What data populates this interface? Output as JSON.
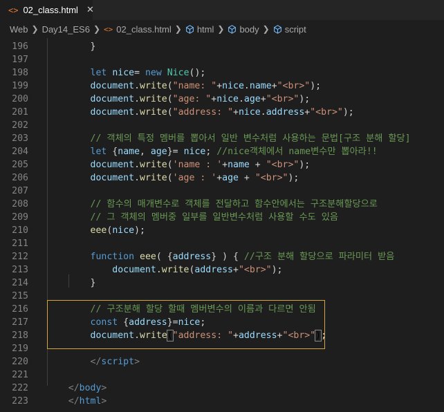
{
  "tab": {
    "title": "02_class.html",
    "icon": "html-file-icon",
    "close": "✕"
  },
  "breadcrumb": [
    "Web",
    "Day14_ES6",
    "02_class.html",
    "html",
    "body",
    "script"
  ],
  "colors": {
    "background": "#1e1e1e",
    "keyword": "#569cd6",
    "string": "#ce9178",
    "comment": "#6a9955",
    "function": "#dcdcaa",
    "variable": "#9cdcfe",
    "highlight_border": "#d7a63a"
  },
  "lines": [
    {
      "n": "196",
      "t": [
        [
          "pl",
          "        }"
        ]
      ]
    },
    {
      "n": "197",
      "t": []
    },
    {
      "n": "198",
      "t": [
        [
          "pl",
          "        "
        ],
        [
          "kw",
          "let"
        ],
        [
          "pl",
          " "
        ],
        [
          "var",
          "nice"
        ],
        [
          "pl",
          "= "
        ],
        [
          "kw",
          "new"
        ],
        [
          "pl",
          " "
        ],
        [
          "cls",
          "Nice"
        ],
        [
          "pl",
          "();"
        ]
      ]
    },
    {
      "n": "199",
      "t": [
        [
          "pl",
          "        "
        ],
        [
          "var",
          "document"
        ],
        [
          "pl",
          "."
        ],
        [
          "fn",
          "write"
        ],
        [
          "pl",
          "("
        ],
        [
          "str",
          "\"name: \""
        ],
        [
          "pl",
          "+"
        ],
        [
          "var",
          "nice"
        ],
        [
          "pl",
          "."
        ],
        [
          "var",
          "name"
        ],
        [
          "pl",
          "+"
        ],
        [
          "str",
          "\"<br>\""
        ],
        [
          "pl",
          ");"
        ]
      ]
    },
    {
      "n": "200",
      "t": [
        [
          "pl",
          "        "
        ],
        [
          "var",
          "document"
        ],
        [
          "pl",
          "."
        ],
        [
          "fn",
          "write"
        ],
        [
          "pl",
          "("
        ],
        [
          "str",
          "\"age: \""
        ],
        [
          "pl",
          "+"
        ],
        [
          "var",
          "nice"
        ],
        [
          "pl",
          "."
        ],
        [
          "var",
          "age"
        ],
        [
          "pl",
          "+"
        ],
        [
          "str",
          "\"<br>\""
        ],
        [
          "pl",
          ");"
        ]
      ]
    },
    {
      "n": "201",
      "t": [
        [
          "pl",
          "        "
        ],
        [
          "var",
          "document"
        ],
        [
          "pl",
          "."
        ],
        [
          "fn",
          "write"
        ],
        [
          "pl",
          "("
        ],
        [
          "str",
          "\"address: \""
        ],
        [
          "pl",
          "+"
        ],
        [
          "var",
          "nice"
        ],
        [
          "pl",
          "."
        ],
        [
          "var",
          "address"
        ],
        [
          "pl",
          "+"
        ],
        [
          "str",
          "\"<br>\""
        ],
        [
          "pl",
          ");"
        ]
      ]
    },
    {
      "n": "202",
      "t": []
    },
    {
      "n": "203",
      "t": [
        [
          "pl",
          "        "
        ],
        [
          "cmt",
          "// 객체의 특정 멤버를 뽑아서 일반 변수처럼 사용하는 문법[구조 분해 할당]"
        ]
      ]
    },
    {
      "n": "204",
      "t": [
        [
          "pl",
          "        "
        ],
        [
          "kw",
          "let"
        ],
        [
          "pl",
          " {"
        ],
        [
          "var",
          "name"
        ],
        [
          "pl",
          ", "
        ],
        [
          "var",
          "age"
        ],
        [
          "pl",
          "}= "
        ],
        [
          "var",
          "nice"
        ],
        [
          "pl",
          "; "
        ],
        [
          "cmt",
          "//nice객체에서 name변수만 뽑아라!!"
        ]
      ]
    },
    {
      "n": "205",
      "t": [
        [
          "pl",
          "        "
        ],
        [
          "var",
          "document"
        ],
        [
          "pl",
          "."
        ],
        [
          "fn",
          "write"
        ],
        [
          "pl",
          "("
        ],
        [
          "str",
          "'name : '"
        ],
        [
          "pl",
          "+"
        ],
        [
          "var",
          "name"
        ],
        [
          "pl",
          " + "
        ],
        [
          "str",
          "\"<br>\""
        ],
        [
          "pl",
          ");"
        ]
      ]
    },
    {
      "n": "206",
      "t": [
        [
          "pl",
          "        "
        ],
        [
          "var",
          "document"
        ],
        [
          "pl",
          "."
        ],
        [
          "fn",
          "write"
        ],
        [
          "pl",
          "("
        ],
        [
          "str",
          "'age : '"
        ],
        [
          "pl",
          "+"
        ],
        [
          "var",
          "age"
        ],
        [
          "pl",
          " + "
        ],
        [
          "str",
          "\"<br>\""
        ],
        [
          "pl",
          ");"
        ]
      ]
    },
    {
      "n": "207",
      "t": []
    },
    {
      "n": "208",
      "t": [
        [
          "pl",
          "        "
        ],
        [
          "cmt",
          "// 함수의 매개변수로 객체를 전달하고 함수안에서는 구조분해할당으로"
        ]
      ]
    },
    {
      "n": "209",
      "t": [
        [
          "pl",
          "        "
        ],
        [
          "cmt",
          "// 그 객체의 멤버중 일부를 일반변수처럼 사용할 수도 있음"
        ]
      ]
    },
    {
      "n": "210",
      "t": [
        [
          "pl",
          "        "
        ],
        [
          "fn",
          "eee"
        ],
        [
          "pl",
          "("
        ],
        [
          "var",
          "nice"
        ],
        [
          "pl",
          ");"
        ]
      ]
    },
    {
      "n": "211",
      "t": []
    },
    {
      "n": "212",
      "t": [
        [
          "pl",
          "        "
        ],
        [
          "kw",
          "function"
        ],
        [
          "pl",
          " "
        ],
        [
          "fn",
          "eee"
        ],
        [
          "pl",
          "( {"
        ],
        [
          "var",
          "address"
        ],
        [
          "pl",
          "} ) { "
        ],
        [
          "cmt",
          "//구조 분해 할당으로 파라미터 받음"
        ]
      ]
    },
    {
      "n": "213",
      "t": [
        [
          "pl",
          "            "
        ],
        [
          "var",
          "document"
        ],
        [
          "pl",
          "."
        ],
        [
          "fn",
          "write"
        ],
        [
          "pl",
          "("
        ],
        [
          "var",
          "address"
        ],
        [
          "pl",
          "+"
        ],
        [
          "str",
          "\"<br>\""
        ],
        [
          "pl",
          ");"
        ]
      ]
    },
    {
      "n": "214",
      "t": [
        [
          "pl",
          "        }"
        ]
      ]
    },
    {
      "n": "215",
      "t": []
    },
    {
      "n": "216",
      "t": [
        [
          "pl",
          "        "
        ],
        [
          "cmt",
          "// 구조분해 할당 할때 멤버변수의 이름과 다르면 안됨"
        ]
      ]
    },
    {
      "n": "217",
      "t": [
        [
          "pl",
          "        "
        ],
        [
          "kw",
          "const"
        ],
        [
          "pl",
          " {"
        ],
        [
          "var",
          "address"
        ],
        [
          "pl",
          "}="
        ],
        [
          "var",
          "nice"
        ],
        [
          "pl",
          ";"
        ]
      ]
    },
    {
      "n": "218",
      "t": [
        [
          "pl",
          "        "
        ],
        [
          "var",
          "document"
        ],
        [
          "pl",
          "."
        ],
        [
          "fn",
          "write"
        ],
        [
          "bm",
          "("
        ],
        [
          "str",
          "\"address: \""
        ],
        [
          "pl",
          "+"
        ],
        [
          "var",
          "address"
        ],
        [
          "pl",
          "+"
        ],
        [
          "str",
          "\"<br>\""
        ],
        [
          "bm",
          ")"
        ],
        [
          "pl",
          ";"
        ]
      ]
    },
    {
      "n": "219",
      "t": []
    },
    {
      "n": "220",
      "t": [
        [
          "pl",
          "        "
        ],
        [
          "tag",
          "</"
        ],
        [
          "tagn",
          "script"
        ],
        [
          "tag",
          ">"
        ]
      ]
    },
    {
      "n": "221",
      "t": []
    },
    {
      "n": "222",
      "t": [
        [
          "pl",
          "    "
        ],
        [
          "tag",
          "</"
        ],
        [
          "tagn",
          "body"
        ],
        [
          "tag",
          ">"
        ]
      ]
    },
    {
      "n": "223",
      "t": [
        [
          "pl",
          "    "
        ],
        [
          "tag",
          "</"
        ],
        [
          "tagn",
          "html"
        ],
        [
          "tag",
          ">"
        ]
      ]
    }
  ]
}
